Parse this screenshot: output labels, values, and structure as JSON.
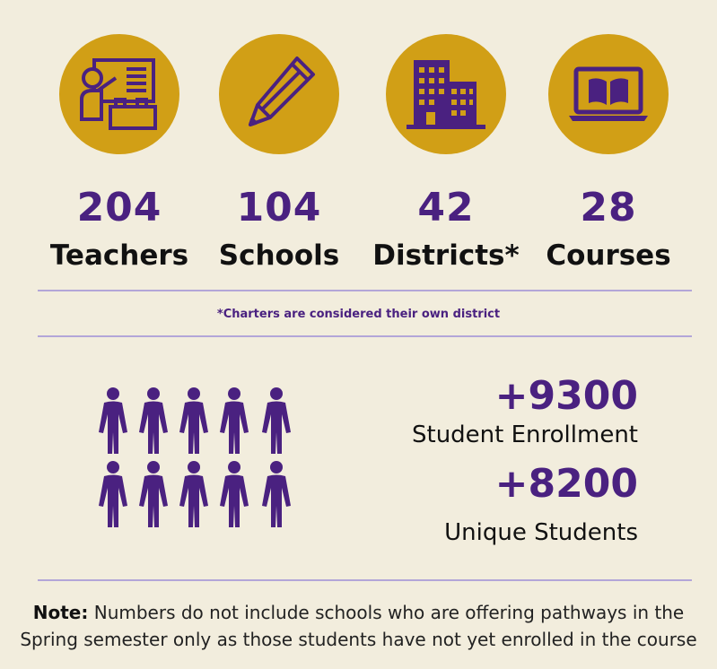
{
  "stats": [
    {
      "number": "204",
      "label": "Teachers",
      "icon": "teacher-board-icon"
    },
    {
      "number": "104",
      "label": "Schools",
      "icon": "pencil-icon"
    },
    {
      "number": "42",
      "label": "Districts*",
      "icon": "buildings-icon"
    },
    {
      "number": "28",
      "label": "Courses",
      "icon": "laptop-book-icon"
    }
  ],
  "footnote": "*Charters are considered their own district",
  "enrollment": {
    "number": "+9300",
    "label": "Student Enrollment"
  },
  "unique": {
    "number": "+8200",
    "label": "Unique Students"
  },
  "people_icon": "people-group-icon",
  "note": {
    "bold": "Note:",
    "line1": " Numbers do not include schools who are offering pathways in the",
    "line2": "Spring semester only as those students have not yet enrolled in the course"
  },
  "colors": {
    "background": "#f2eddd",
    "gold": "#d19f16",
    "purple": "#4a2180",
    "divider": "#b3a6d8"
  }
}
